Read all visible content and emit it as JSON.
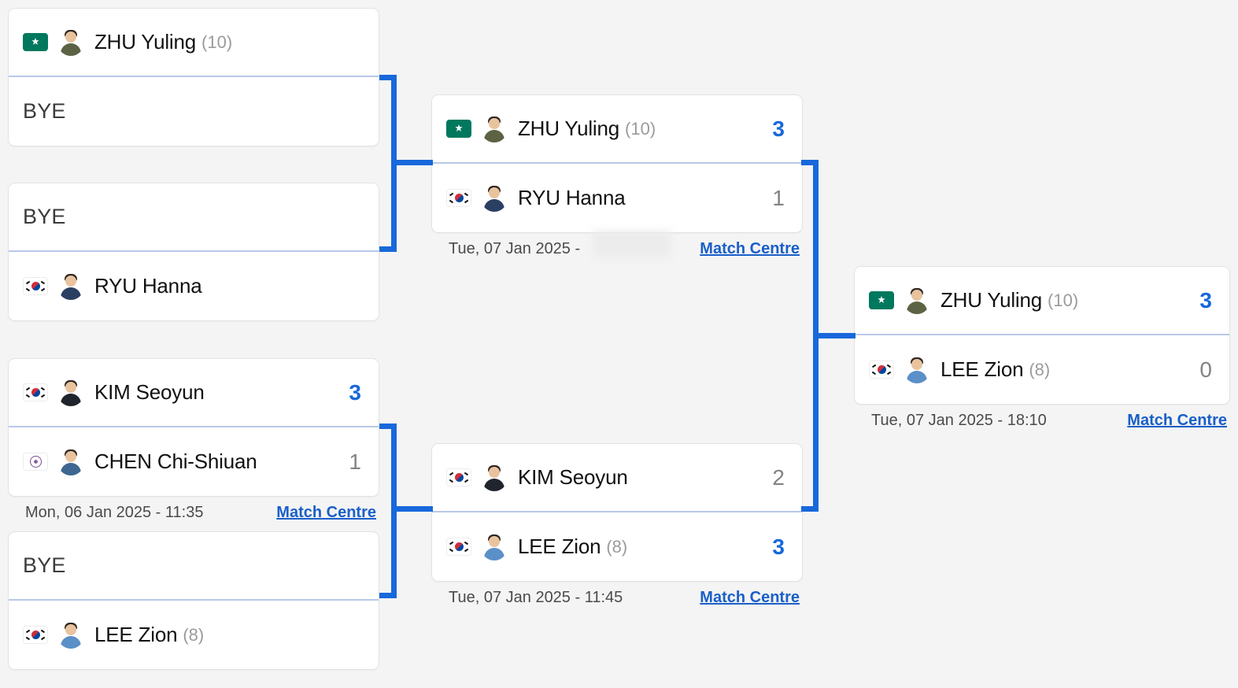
{
  "theme": {
    "background": "#f4f4f4",
    "card_background": "#ffffff",
    "accent_blue": "#1868db",
    "link_blue": "#1a5fc8",
    "loser_score": "#838383",
    "divider": "#b9c8e8"
  },
  "labels": {
    "bye": "BYE",
    "match_centre": "Match Centre"
  },
  "rounds": [
    {
      "name": "round-of-16",
      "matches": [
        {
          "id": "r1-m1",
          "players": [
            {
              "name": "ZHU Yuling",
              "seed": "(10)",
              "flag": "mac",
              "flag_name": "macau-flag",
              "avatar": "green",
              "score": "",
              "winner": false,
              "bye": false
            },
            {
              "name": "",
              "seed": "",
              "flag": "",
              "flag_name": "",
              "avatar": "",
              "score": "",
              "winner": false,
              "bye": true
            }
          ],
          "date": "",
          "has_meta": false
        },
        {
          "id": "r1-m2",
          "players": [
            {
              "name": "",
              "seed": "",
              "flag": "",
              "flag_name": "",
              "avatar": "",
              "score": "",
              "winner": false,
              "bye": true
            },
            {
              "name": "RYU Hanna",
              "seed": "",
              "flag": "kor",
              "flag_name": "south-korea-flag",
              "avatar": "navy",
              "score": "",
              "winner": false,
              "bye": false
            }
          ],
          "date": "",
          "has_meta": false
        },
        {
          "id": "r1-m3",
          "players": [
            {
              "name": "KIM Seoyun",
              "seed": "",
              "flag": "kor",
              "flag_name": "south-korea-flag",
              "avatar": "dark",
              "score": "3",
              "winner": true,
              "bye": false
            },
            {
              "name": "CHEN Chi-Shiuan",
              "seed": "",
              "flag": "tpe",
              "flag_name": "chinese-taipei-flag",
              "avatar": "steel",
              "score": "1",
              "winner": false,
              "bye": false
            }
          ],
          "date": "Mon, 06 Jan 2025 - 11:35",
          "has_meta": true
        },
        {
          "id": "r1-m4",
          "players": [
            {
              "name": "",
              "seed": "",
              "flag": "",
              "flag_name": "",
              "avatar": "",
              "score": "",
              "winner": false,
              "bye": true
            },
            {
              "name": "LEE Zion",
              "seed": "(8)",
              "flag": "kor",
              "flag_name": "south-korea-flag",
              "avatar": "blue",
              "score": "",
              "winner": false,
              "bye": false
            }
          ],
          "date": "",
          "has_meta": false
        }
      ]
    },
    {
      "name": "semi-finals",
      "matches": [
        {
          "id": "r2-m1",
          "players": [
            {
              "name": "ZHU Yuling",
              "seed": "(10)",
              "flag": "mac",
              "flag_name": "macau-flag",
              "avatar": "green",
              "score": "3",
              "winner": true,
              "bye": false
            },
            {
              "name": "RYU Hanna",
              "seed": "",
              "flag": "kor",
              "flag_name": "south-korea-flag",
              "avatar": "navy",
              "score": "1",
              "winner": false,
              "bye": false
            }
          ],
          "date": "Tue, 07 Jan 2025 -",
          "has_meta": true,
          "redacted_time": true
        },
        {
          "id": "r2-m2",
          "players": [
            {
              "name": "KIM Seoyun",
              "seed": "",
              "flag": "kor",
              "flag_name": "south-korea-flag",
              "avatar": "dark",
              "score": "2",
              "winner": false,
              "bye": false
            },
            {
              "name": "LEE Zion",
              "seed": "(8)",
              "flag": "kor",
              "flag_name": "south-korea-flag",
              "avatar": "blue",
              "score": "3",
              "winner": true,
              "bye": false
            }
          ],
          "date": "Tue, 07 Jan 2025 - 11:45",
          "has_meta": true
        }
      ]
    },
    {
      "name": "final",
      "matches": [
        {
          "id": "r3-m1",
          "players": [
            {
              "name": "ZHU Yuling",
              "seed": "(10)",
              "flag": "mac",
              "flag_name": "macau-flag",
              "avatar": "green",
              "score": "3",
              "winner": true,
              "bye": false
            },
            {
              "name": "LEE Zion",
              "seed": "(8)",
              "flag": "kor",
              "flag_name": "south-korea-flag",
              "avatar": "blue",
              "score": "0",
              "winner": false,
              "bye": false
            }
          ],
          "date": "Tue, 07 Jan 2025 - 18:10",
          "has_meta": true
        }
      ]
    }
  ]
}
